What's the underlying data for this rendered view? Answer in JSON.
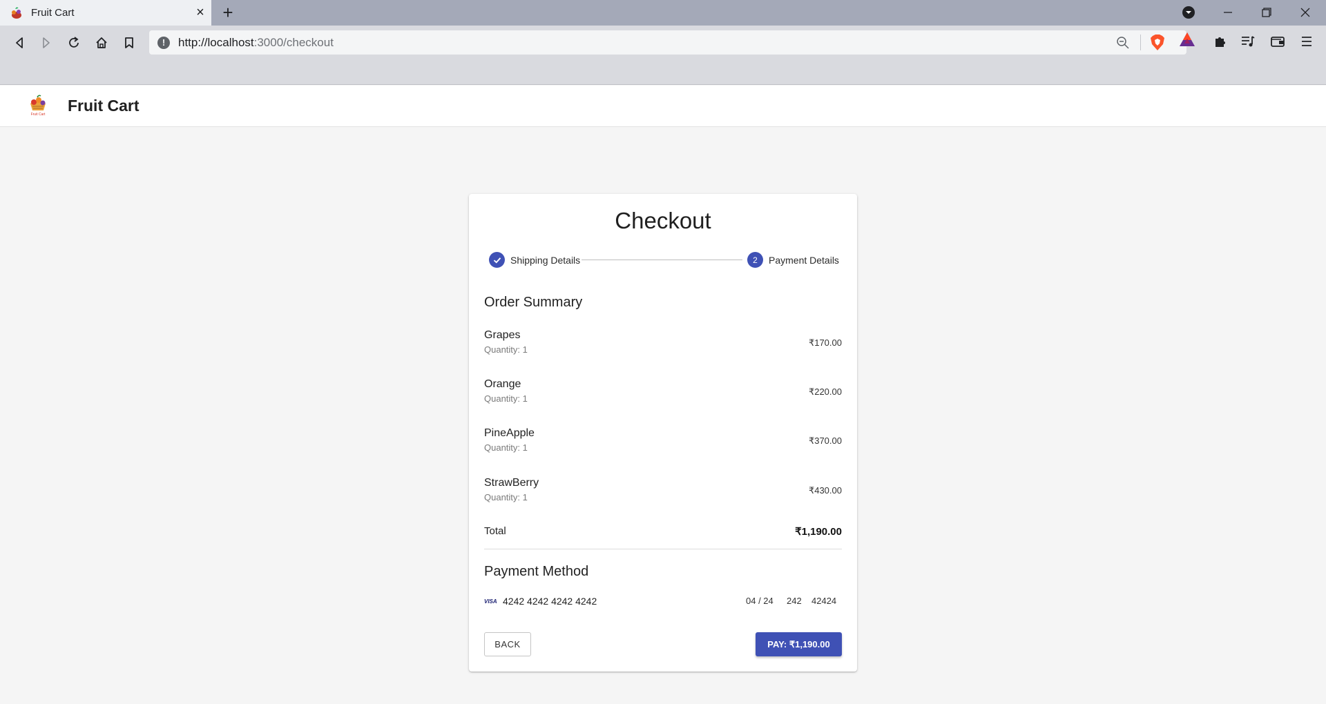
{
  "browser": {
    "tab_title": "Fruit Cart",
    "url_host": "http://localhost",
    "url_rest": ":3000/checkout"
  },
  "app": {
    "title": "Fruit Cart",
    "logo_text": "Fruit Cart"
  },
  "checkout": {
    "title": "Checkout",
    "steps": [
      {
        "label": "Shipping Details",
        "state": "completed"
      },
      {
        "label": "Payment Details",
        "number": "2",
        "state": "active"
      }
    ],
    "order_summary_title": "Order Summary",
    "items": [
      {
        "name": "Grapes",
        "quantity": "Quantity: 1",
        "price": "₹170.00"
      },
      {
        "name": "Orange",
        "quantity": "Quantity: 1",
        "price": "₹220.00"
      },
      {
        "name": "PineApple",
        "quantity": "Quantity: 1",
        "price": "₹370.00"
      },
      {
        "name": "StrawBerry",
        "quantity": "Quantity: 1",
        "price": "₹430.00"
      }
    ],
    "total_label": "Total",
    "total_value": "₹1,190.00",
    "payment_method_title": "Payment Method",
    "card": {
      "brand": "VISA",
      "number": "4242 4242 4242 4242",
      "expiry": "04 / 24",
      "cvc": "242",
      "zip": "42424"
    },
    "back_label": "BACK",
    "pay_label": "PAY: ₹1,190.00"
  },
  "colors": {
    "primary": "#3f51b5",
    "page_background": "#f5f5f5"
  }
}
